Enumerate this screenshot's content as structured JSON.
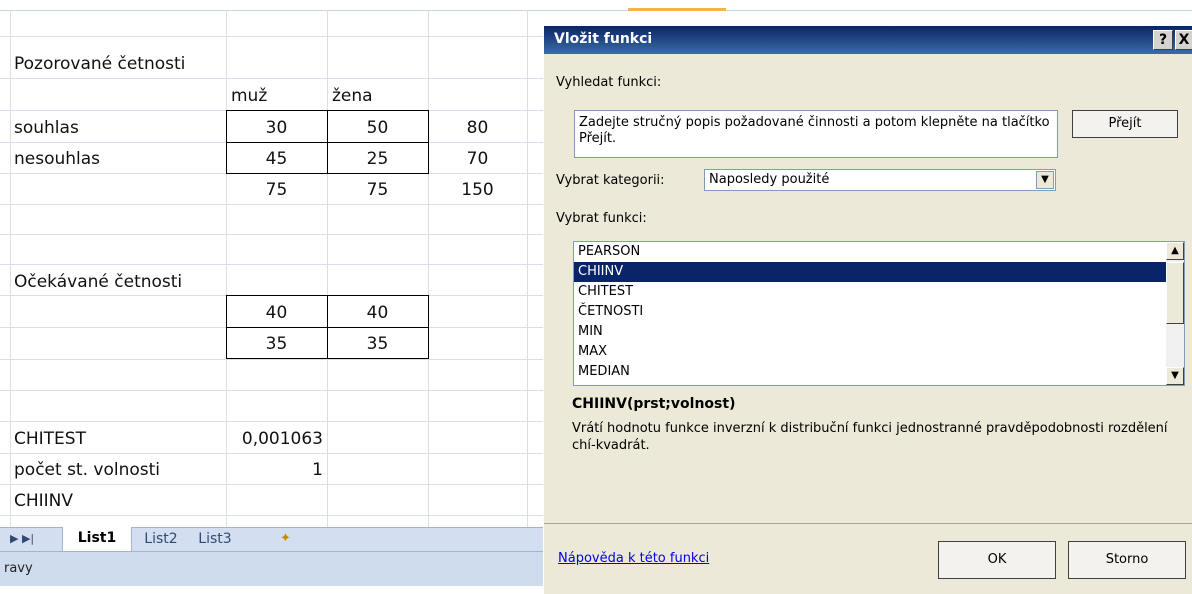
{
  "sheet": {
    "observed_title": "Pozorované četnosti",
    "col_headers": [
      "muž",
      "žena"
    ],
    "rows": [
      {
        "label": "souhlas",
        "values": [
          "30",
          "50",
          "80"
        ]
      },
      {
        "label": "nesouhlas",
        "values": [
          "45",
          "25",
          "70"
        ]
      },
      {
        "label": "",
        "values": [
          "75",
          "75",
          "150"
        ]
      }
    ],
    "expected_title": "Očekávané četnosti",
    "expected_rows": [
      [
        "40",
        "40"
      ],
      [
        "35",
        "35"
      ]
    ],
    "chitest_label": "CHITEST",
    "chitest_value": "0,001063",
    "df_label": "počet st. volnosti",
    "df_value": "1",
    "chiinv_label": "CHIINV"
  },
  "tabs": [
    "List1",
    "List2",
    "List3"
  ],
  "status_text": "ravy",
  "dialog": {
    "title": "Vložit funkci",
    "help_btn": "?",
    "close_btn": "X",
    "search_label": "Vyhledat funkci:",
    "search_text": "Zadejte stručný popis požadované činnosti a potom klepněte na tlačítko Přejít.",
    "go_button": "Přejít",
    "category_label": "Vybrat kategorii:",
    "category_value": "Naposledy použité",
    "function_label": "Vybrat funkci:",
    "functions": [
      "PEARSON",
      "CHIINV",
      "CHITEST",
      "ČETNOSTI",
      "MIN",
      "MAX",
      "MEDIAN"
    ],
    "selected_function": "CHIINV",
    "signature": "CHIINV(prst;volnost)",
    "description": "Vrátí hodnotu funkce inverzní k distribuční funkci jednostranné pravděpodobnosti rozdělení chí-kvadrát.",
    "help_link": "Nápověda k této funkci",
    "ok_button": "OK",
    "cancel_button": "Storno"
  }
}
